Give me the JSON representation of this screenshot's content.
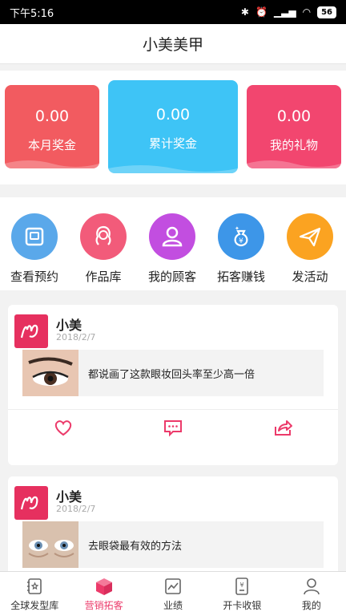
{
  "status": {
    "time": "下午5:16",
    "battery": "56"
  },
  "header": {
    "title": "小美美甲"
  },
  "stats": [
    {
      "value": "0.00",
      "label": "本月奖金"
    },
    {
      "value": "0.00",
      "label": "累计奖金"
    },
    {
      "value": "0.00",
      "label": "我的礼物"
    }
  ],
  "actions": [
    {
      "label": "查看预约",
      "icon": "appointment-icon",
      "color": "#5aa8ea"
    },
    {
      "label": "作品库",
      "icon": "portfolio-icon",
      "color": "#f25b7a"
    },
    {
      "label": "我的顾客",
      "icon": "customers-icon",
      "color": "#c24ee0"
    },
    {
      "label": "拓客赚钱",
      "icon": "money-bag-icon",
      "color": "#3d96e8"
    },
    {
      "label": "发活动",
      "icon": "paper-plane-icon",
      "color": "#fba321"
    }
  ],
  "posts": [
    {
      "author": "小美",
      "date": "2018/2/7",
      "title": "都说画了这款眼妆回头率至少高一倍"
    },
    {
      "author": "小美",
      "date": "2018/2/7",
      "title": "去眼袋最有效的方法"
    }
  ],
  "nav": [
    {
      "label": "全球发型库",
      "icon": "hairstyle-library-icon"
    },
    {
      "label": "营销拓客",
      "icon": "marketing-box-icon"
    },
    {
      "label": "业绩",
      "icon": "performance-chart-icon"
    },
    {
      "label": "开卡收银",
      "icon": "cashier-icon"
    },
    {
      "label": "我的",
      "icon": "profile-icon"
    }
  ],
  "colors": {
    "accent": "#ec3a6a"
  }
}
